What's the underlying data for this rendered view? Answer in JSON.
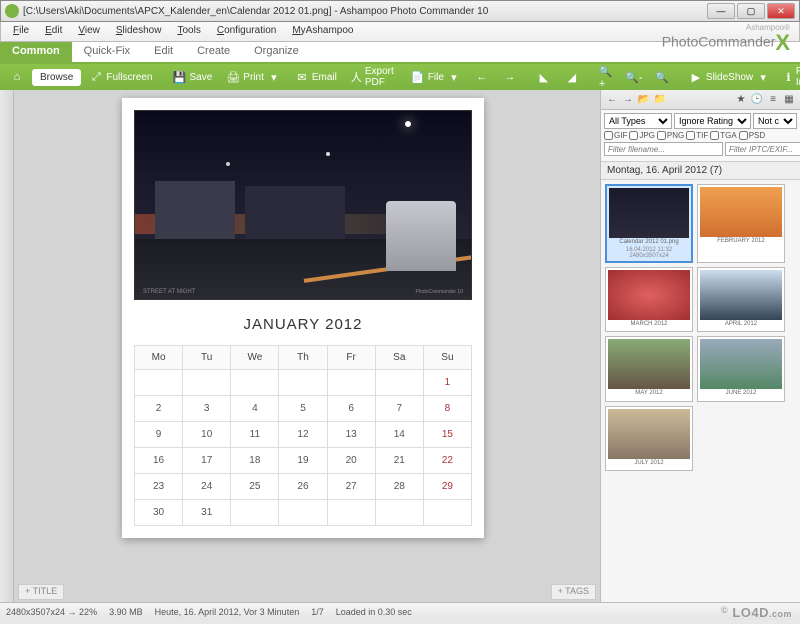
{
  "window": {
    "title": "[C:\\Users\\Aki\\Documents\\APCX_Kalender_en\\Calendar 2012 01.png] - Ashampoo Photo Commander 10",
    "min": "—",
    "max": "▢",
    "close": "✕"
  },
  "menu": {
    "file": "File",
    "edit": "Edit",
    "view": "View",
    "slideshow": "Slideshow",
    "tools": "Tools",
    "configuration": "Configuration",
    "myashampoo": "MyAshampoo"
  },
  "brand": {
    "ash": "Ashampoo®",
    "name": "PhotoCommander",
    "x": "X"
  },
  "tabs": {
    "common": "Common",
    "quickfix": "Quick-Fix",
    "edit": "Edit",
    "create": "Create",
    "organize": "Organize"
  },
  "toolbar": {
    "browse": "Browse",
    "fullscreen": "Fullscreen",
    "save": "Save",
    "print": "Print",
    "email": "Email",
    "exportpdf": "Export PDF",
    "file": "File",
    "slideshow": "SlideShow",
    "fileinfo": "File Info"
  },
  "doc": {
    "caption": "STREET AT NIGHT",
    "caption_r": "PhotoCommander 10",
    "month": "JANUARY 2012",
    "days": [
      "Mo",
      "Tu",
      "We",
      "Th",
      "Fr",
      "Sa",
      "Su"
    ],
    "rows": [
      [
        "",
        "",
        "",
        "",
        "",
        "",
        "1"
      ],
      [
        "2",
        "3",
        "4",
        "5",
        "6",
        "7",
        "8"
      ],
      [
        "9",
        "10",
        "11",
        "12",
        "13",
        "14",
        "15"
      ],
      [
        "16",
        "17",
        "18",
        "19",
        "20",
        "21",
        "22"
      ],
      [
        "23",
        "24",
        "25",
        "26",
        "27",
        "28",
        "29"
      ],
      [
        "30",
        "31",
        "",
        "",
        "",
        "",
        ""
      ]
    ],
    "title_btn": "+ TITLE",
    "tags_btn": "+ TAGS"
  },
  "panel": {
    "type_all": "All Types",
    "rating": "Ignore Rating",
    "notc": "Not c",
    "formats": [
      "GIF",
      "JPG",
      "PNG",
      "TIF",
      "TGA",
      "PSD"
    ],
    "filter_name": "Filter filename...",
    "filter_iptc": "Filter IPTC/EXIF...",
    "header": "Montag, 16. April 2012 (7)",
    "thumbs": [
      {
        "label": "Calendar 2012 01.png",
        "meta1": "16.04.2012 11:32",
        "meta2": "2480x3507x24",
        "cls": "street",
        "sel": true
      },
      {
        "label": "FEBRUARY 2012",
        "cls": "sunset"
      },
      {
        "label": "MARCH 2012",
        "cls": "flower"
      },
      {
        "label": "APRIL 2012",
        "cls": "trees"
      },
      {
        "label": "MAY 2012",
        "cls": "castle"
      },
      {
        "label": "JUNE 2012",
        "cls": "grass"
      },
      {
        "label": "JULY 2012",
        "cls": "husk"
      }
    ]
  },
  "status": {
    "dims": "2480x3507x24 → 22%",
    "size": "3.90 MB",
    "date": "Heute, 16. April 2012, Vor 3 Minuten",
    "page": "1/7",
    "loaded": "Loaded in 0.30 sec"
  },
  "watermark": "LO4D",
  "watermark_suffix": ".com"
}
